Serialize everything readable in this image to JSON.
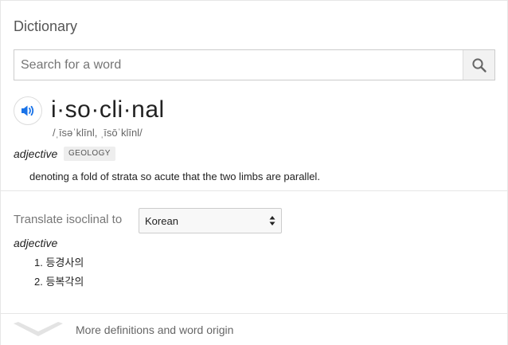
{
  "header": {
    "title": "Dictionary"
  },
  "search": {
    "placeholder": "Search for a word",
    "value": "",
    "button_icon": "search-icon"
  },
  "entry": {
    "speaker_icon": "speaker-icon",
    "headword": "i·so·cli·nal",
    "pronunciation": "/ˌīsəˈklīnl, ˌīsōˈklīnl/",
    "part_of_speech": "adjective",
    "subject_label": "GEOLOGY",
    "definition": "denoting a fold of strata so acute that the two limbs are parallel."
  },
  "translate": {
    "label": "Translate isoclinal to",
    "language": "Korean",
    "part_of_speech": "adjective",
    "items": [
      "1. 등경사의",
      "2. 등복각의"
    ]
  },
  "footer": {
    "more_label": "More definitions and word origin",
    "chevron_icon": "chevron-down-icon"
  },
  "colors": {
    "speaker_blue": "#1a73e8",
    "border": "#cccccc",
    "muted_text": "#777777"
  }
}
